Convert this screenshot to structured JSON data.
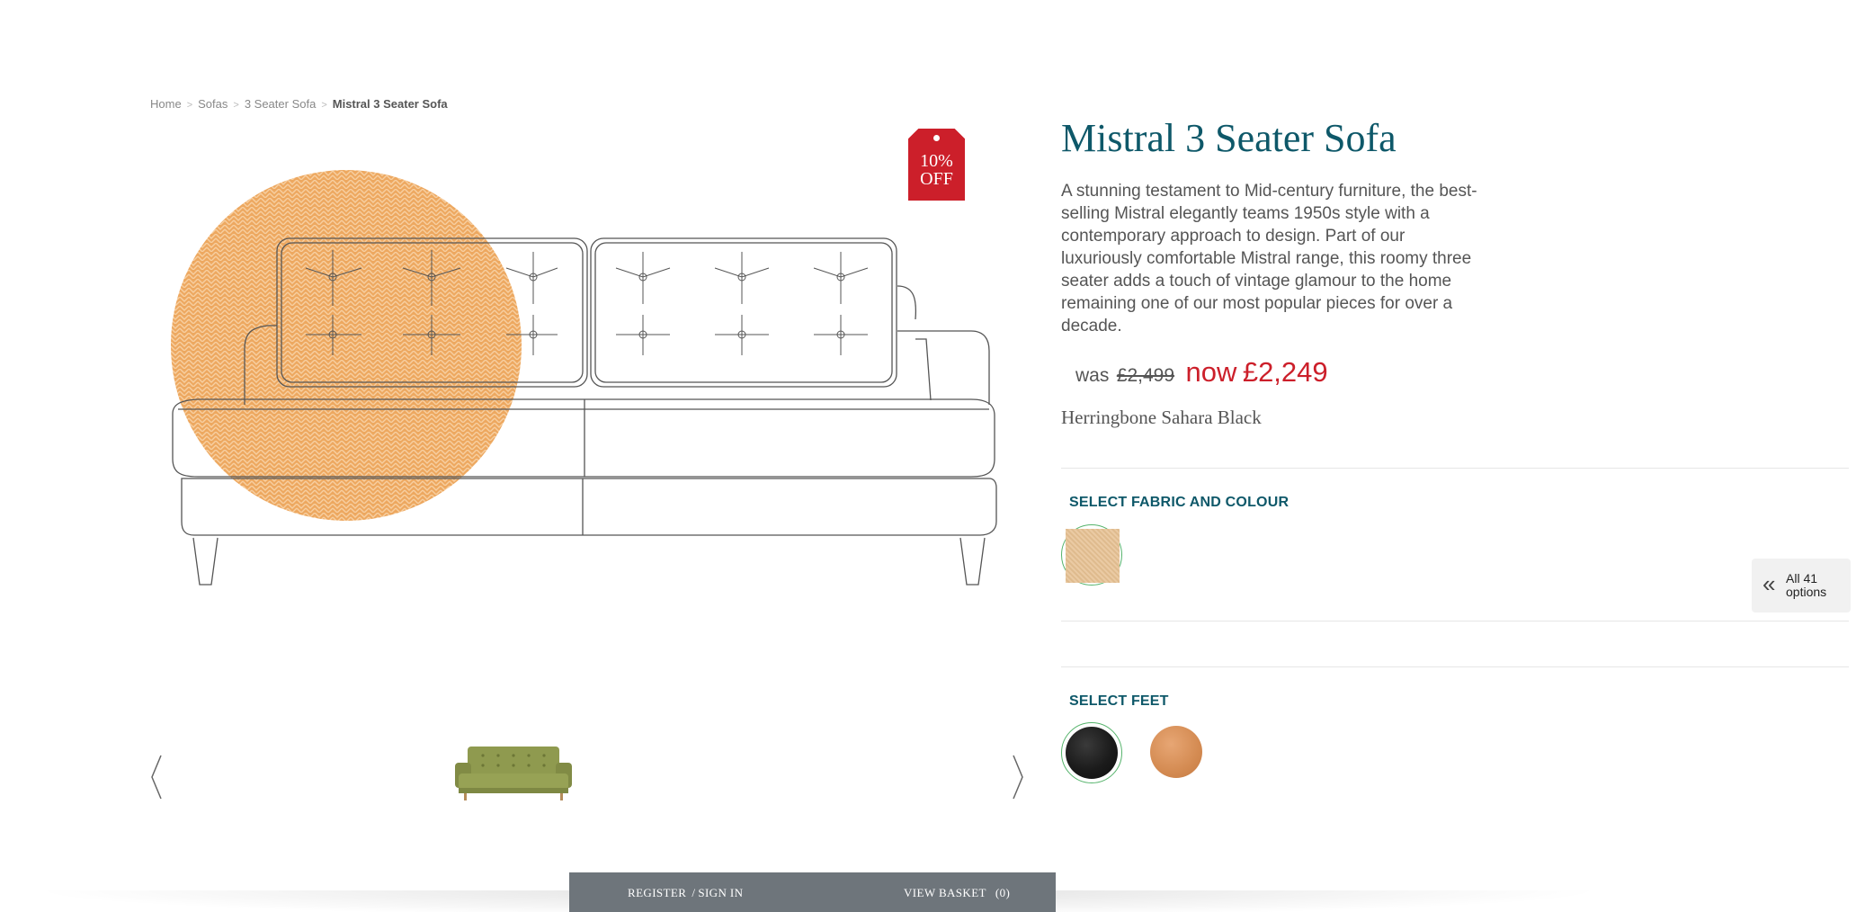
{
  "breadcrumb": {
    "items": [
      "Home",
      "Sofas",
      "3 Seater Sofa"
    ],
    "current": "Mistral 3 Seater Sofa",
    "separator": ">"
  },
  "sale_tag": {
    "line1": "10%",
    "line2": "OFF"
  },
  "product": {
    "title": "Mistral 3 Seater Sofa",
    "description": "A stunning testament to Mid-century furniture, the best-selling Mistral elegantly teams 1950s style with a contemporary approach to design. Part of our luxuriously comfortable Mistral range, this roomy three seater adds a touch of vintage glamour to the home remaining one of our most popular pieces for over a decade.",
    "was_label": "was",
    "was_price": "£2,499",
    "now_label": "now",
    "now_price": "£2,249",
    "fabric_name": "Herringbone Sahara Black"
  },
  "fabric_section": {
    "label": "SELECT FABRIC AND COLOUR",
    "all_options_line1": "All 41",
    "all_options_line2": "options"
  },
  "feet_section": {
    "label": "SELECT FEET",
    "options": [
      "black-feet",
      "oak-feet"
    ]
  },
  "bottom_bar": {
    "register": "REGISTER",
    "sign_in": "SIGN IN",
    "slash": "/",
    "basket": "VIEW BASKET",
    "basket_count": "(0)"
  },
  "colors": {
    "brand_teal": "#0e5869",
    "sale_red": "#cc1f2a",
    "selected_ring": "#55b36b",
    "fabric_orange": "#eda860"
  }
}
